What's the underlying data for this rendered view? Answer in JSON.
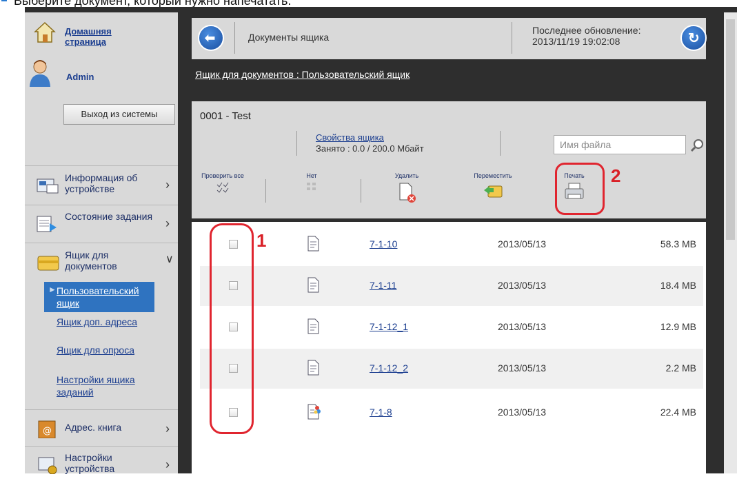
{
  "caption": "Выберите документ, который нужно напечатать.",
  "sidebar": {
    "home_label": "Домашняя страница",
    "user_name": "Admin",
    "logout_label": "Выход из системы",
    "nav": [
      {
        "label": "Информация об устройстве"
      },
      {
        "label": "Состояние задания"
      },
      {
        "label": "Ящик для документов"
      },
      {
        "label": "Адрес. книга"
      },
      {
        "label": "Настройки устройства"
      }
    ],
    "sub": [
      {
        "label": "Пользовательский ящик"
      },
      {
        "label": "Ящик доп. адреса"
      },
      {
        "label": "Ящик для опроса"
      },
      {
        "label": "Настройки ящика заданий"
      }
    ]
  },
  "header": {
    "title": "Документы ящика",
    "updated_label": "Последнее обновление:",
    "updated_value": "2013/11/19 19:02:08"
  },
  "breadcrumb": "Ящик для документов : Пользовательский ящик",
  "box": {
    "name": "0001 - Test",
    "props_link": "Свойства ящика",
    "used": "Занято : 0.0 / 200.0 Мбайт",
    "search_placeholder": "Имя файла"
  },
  "toolbar": {
    "check_all": "Проверить все",
    "none": "Нет",
    "delete": "Удалить",
    "move": "Переместить",
    "print": "Печать"
  },
  "callouts": {
    "one": "1",
    "two": "2"
  },
  "files": [
    {
      "name": "7-1-10",
      "date": "2013/05/13",
      "size": "58.3 MB",
      "icon": "document-icon"
    },
    {
      "name": "7-1-11",
      "date": "2013/05/13",
      "size": "18.4 MB",
      "icon": "document-icon"
    },
    {
      "name": "7-1-12_1",
      "date": "2013/05/13",
      "size": "12.9 MB",
      "icon": "document-icon"
    },
    {
      "name": "7-1-12_2",
      "date": "2013/05/13",
      "size": "2.2 MB",
      "icon": "document-icon"
    },
    {
      "name": "7-1-8",
      "date": "2013/05/13",
      "size": "22.4 MB",
      "icon": "color-document-icon"
    }
  ],
  "colors": {
    "accent": "#2f73c0",
    "callout": "#e0252f",
    "frame": "#2e2e2e",
    "panel": "#d9d9d9"
  }
}
